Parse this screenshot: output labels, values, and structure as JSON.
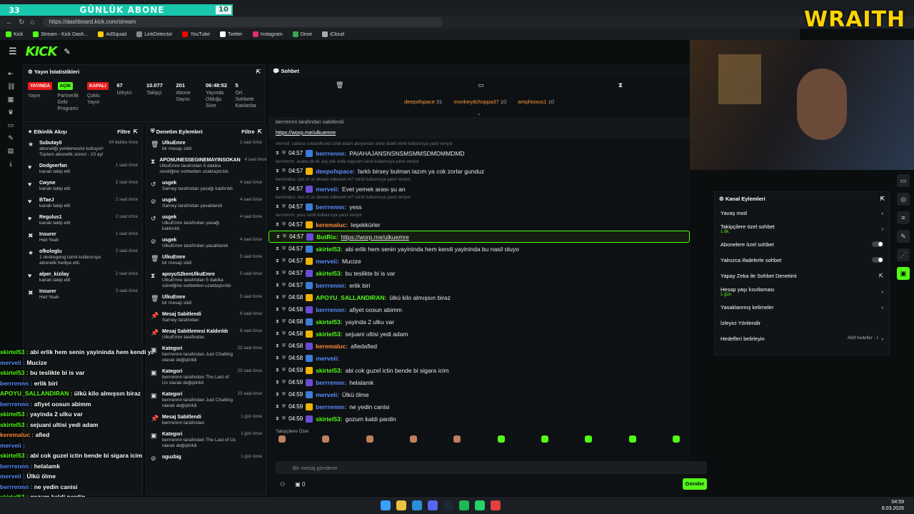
{
  "browser": {
    "url": "https://dashboard.kick.com/stream",
    "bookmarks": [
      "Kick",
      "Stream - Kick Dash...",
      "AdSquad",
      "LinkDetector",
      "YouTube",
      "Twitter",
      "Instagram",
      "Drive",
      "iCloud"
    ]
  },
  "sub_goal": {
    "count_left": "33",
    "title": "GÜNLÜK ABONE",
    "count_right": "10"
  },
  "overlay_brand": "WRAITH",
  "stats": {
    "title": "Yayın İstatistikleri",
    "items": [
      {
        "badge": "YAYINDA",
        "badge_color": "#e81c1c",
        "label": "Yayın"
      },
      {
        "badge": "AÇIK",
        "badge_color": "#53fc18",
        "label": "Partnerlik Gelir Programı"
      },
      {
        "badge": "KAPALI",
        "badge_color": "#e81c1c",
        "label": "Çoklu Yayın"
      },
      {
        "value": "67",
        "label": "İzleyici"
      },
      {
        "value": "10.077",
        "label": "Takipçi"
      },
      {
        "value": "201",
        "label": "Abone Sayısı"
      },
      {
        "value": "06:48:52",
        "label": "Yayında Olduğu Süre"
      },
      {
        "value": "5",
        "label": "Ort. Sohbete Katılanlar"
      }
    ]
  },
  "activity": {
    "title": "Etkinlik Akışı",
    "filter": "Filtre",
    "items": [
      {
        "name": "Subutay0",
        "text": "aboneliği yenilemesini kutluyor! Toplam abonelik süresi - 10 ay!",
        "time": "54 dakika önce",
        "icon": "★"
      },
      {
        "name": "Dodgeerfan",
        "text": "kanalı takip etti",
        "time": "1 saat önce",
        "icon": "♥"
      },
      {
        "name": "Cwyne",
        "text": "kanalı takip etti",
        "time": "2 saat önce",
        "icon": "♥"
      },
      {
        "name": "BTaeJ",
        "text": "kanalı takip etti",
        "time": "2 saat önce",
        "icon": "♥"
      },
      {
        "name": "Regulus1",
        "text": "kanalı takip etti",
        "time": "2 saat önce",
        "icon": "♥"
      },
      {
        "name": "Insurer",
        "text": "Heil Yeah",
        "time": "1 saat önce",
        "icon": "✖"
      },
      {
        "name": "ofkologlu",
        "text": "1 okokegeng isimli kullanıcıya abonelik hediye etti.",
        "time": "2 saat önce",
        "icon": "★"
      },
      {
        "name": "alper_kizilay",
        "text": "kanalı takip etti",
        "time": "2 saat önce",
        "icon": "♥"
      },
      {
        "name": "Insurer",
        "text": "Heil Yeah",
        "time": "3 saat önce",
        "icon": "✖"
      }
    ]
  },
  "modlog": {
    "title": "Denetim Eylemleri",
    "filter": "Filtre",
    "items": [
      {
        "name": "UlkuEmre",
        "text": "bir mesajı sildi",
        "time": "1 saat önce",
        "icon": "🗑"
      },
      {
        "name": "APONUNESSEGINEMAYINSOKAN",
        "text": "UlkuEmre tarafından 5 dakika süreliğine sohbetten uzaklaştırıldı",
        "time": "4 saat önce",
        "icon": "⧗"
      },
      {
        "name": "usgek",
        "text": "Sarney tarafından yasağı kaldırıldı",
        "time": "4 saat önce",
        "icon": "↺"
      },
      {
        "name": "usgek",
        "text": "Sarney tarafından yasaklandı",
        "time": "4 saat önce",
        "icon": "⊘"
      },
      {
        "name": "usgek",
        "text": "UlkuEmre tarafından yasağı kaldırıldı",
        "time": "4 saat önce",
        "icon": "↺"
      },
      {
        "name": "usgek",
        "text": "UlkuEmre tarafından yasaklandı",
        "time": "4 saat önce",
        "icon": "⊘"
      },
      {
        "name": "UlkuEmre",
        "text": "bir mesajı sildi",
        "time": "5 saat önce",
        "icon": "🗑"
      },
      {
        "name": "apoyuS2kenUlkuEmre",
        "text": "UlkuEmre tarafından 5 dakika süreliğine sohbetten uzaklaştırıldı",
        "time": "5 saat önce",
        "icon": "⧗"
      },
      {
        "name": "UlkuEmre",
        "text": "bir mesajı sildi",
        "time": "5 saat önce",
        "icon": "🗑"
      },
      {
        "name": "Mesaj Sabitlendi",
        "text": "Sarney tarafından",
        "time": "6 saat önce",
        "icon": "📌"
      },
      {
        "name": "Mesaj Sabitlemesi Kaldırıldı",
        "text": "UlkuEmre tarafından",
        "time": "6 saat önce",
        "icon": "📌"
      },
      {
        "name": "Kategori",
        "text": "berrrennn tarafından Just Chatting olarak değiştirildi",
        "time": "22 saat önce",
        "icon": "▣"
      },
      {
        "name": "Kategori",
        "text": "berrrennn tarafından The Last of Us olarak değiştirildi",
        "time": "23 saat önce",
        "icon": "▣"
      },
      {
        "name": "Kategori",
        "text": "berrrennn tarafından Just Chatting olarak değiştirildi",
        "time": "23 saat önce",
        "icon": "▣"
      },
      {
        "name": "Mesaj Sabitlendi",
        "text": "berrrennn tarafından",
        "time": "1 gün önce",
        "icon": "📌"
      },
      {
        "name": "Kategori",
        "text": "berrrennn tarafından The Last of Us olarak değiştirildi",
        "time": "1 gün önce",
        "icon": "▣"
      },
      {
        "name": "oguzbig",
        "text": "",
        "time": "1 gün önce",
        "icon": "⊘"
      }
    ]
  },
  "chat": {
    "title": "Sohbet",
    "leaderboard": [
      {
        "name": "deepofspace",
        "count": "31"
      },
      {
        "name": "monkeydchoppa37",
        "count": "10"
      },
      {
        "name": "amphioxus1",
        "count": "10"
      }
    ],
    "pinned_by": "berrrennn tarafından sabitlendi",
    "pinned_link": "https://worp.me/ulkuemre",
    "messages": [
      {
        "time": "04:57",
        "user": "berrrennn",
        "color": "#5b8cff",
        "text": "PAIAHAJANSNSNSMSMMSDMDMMDMD",
        "reply": "merveii: sadece cowardhood isimli adam aboyerdan dene diaeli isimli kullanıcıya yanıt veriyor"
      },
      {
        "time": "04:57",
        "user": "deepofspace",
        "color": "#5b8cff",
        "text": "farklı birsey bulman lazım ya cok zorlar gunduz",
        "reply": "berrrennn: acaba dk bir şey yok evde napcam isimli kullanıcıya yanıt veriyor"
      },
      {
        "time": "04:57",
        "user": "merveii",
        "color": "#5b8cff",
        "text": "Evet yemek arası şu an",
        "reply": "keremaluc: last of us devam edilecek mi? isimli kullanıcıya yanıt veriyor"
      },
      {
        "time": "04:57",
        "user": "berrrennn",
        "color": "#5b8cff",
        "text": "yess",
        "reply": "keremaluc: last of us devam edilecek mi? isimli kullanıcıya yanıt veriyor"
      },
      {
        "time": "04:57",
        "user": "keremaluc",
        "color": "#ff8a3d",
        "text": "teşekkürler",
        "reply": "berrrennn: yess isimli kullanıcıya yanıt veriyor"
      },
      {
        "time": "04:57",
        "user": "BotRix",
        "color": "#53fc18",
        "text": "https://worp.me/ulkuemre",
        "reply": "",
        "highlight": true
      },
      {
        "time": "04:57",
        "user": "skirtel53",
        "color": "#53fc18",
        "text": "abi erlik hem senin yayininda hem kendi yayininda bu nasil oluyo",
        "reply": ""
      },
      {
        "time": "04:57",
        "user": "merveii",
        "color": "#5b8cff",
        "text": "Mucize",
        "reply": ""
      },
      {
        "time": "04:57",
        "user": "skirtel53",
        "color": "#53fc18",
        "text": "bu teslikte bi is var",
        "reply": ""
      },
      {
        "time": "04:57",
        "user": "berrrennn",
        "color": "#5b8cff",
        "text": "erlik biri",
        "reply": ""
      },
      {
        "time": "04:58",
        "user": "APOYU_SALLANDIRAN",
        "color": "#53fc18",
        "text": "ülkü kilo almışsın biraz",
        "reply": ""
      },
      {
        "time": "04:58",
        "user": "berrrennn",
        "color": "#5b8cff",
        "text": "afiyet oosun abimm",
        "reply": ""
      },
      {
        "time": "04:58",
        "user": "skirtel53",
        "color": "#53fc18",
        "text": "yayinda 2 ulku var",
        "reply": ""
      },
      {
        "time": "04:58",
        "user": "skirtel53",
        "color": "#53fc18",
        "text": "sejuani ultisi yedi adam",
        "reply": ""
      },
      {
        "time": "04:58",
        "user": "keremaluc",
        "color": "#ff8a3d",
        "text": "afiedafied",
        "reply": ""
      },
      {
        "time": "04:58",
        "user": "merveii",
        "color": "#5b8cff",
        "text": "",
        "reply": ""
      },
      {
        "time": "04:59",
        "user": "skirtel53",
        "color": "#53fc18",
        "text": "abi cok guzel ictin bende bi sigara icim",
        "reply": ""
      },
      {
        "time": "04:59",
        "user": "berrrennn",
        "color": "#5b8cff",
        "text": "helalamk",
        "reply": ""
      },
      {
        "time": "04:59",
        "user": "merveii",
        "color": "#5b8cff",
        "text": "Ülkü ölme",
        "reply": ""
      },
      {
        "time": "04:59",
        "user": "berrrennn",
        "color": "#5b8cff",
        "text": "ne yedin canisi",
        "reply": ""
      },
      {
        "time": "04:59",
        "user": "skirtel53",
        "color": "#53fc18",
        "text": "gozum kaldi pardin",
        "reply": ""
      }
    ],
    "emote_label": "Takipçilere Özel",
    "input_placeholder": "Bir mesaj gönderin",
    "points": "0",
    "send_label": "Gönder"
  },
  "channel_actions": {
    "title": "Kanal Eylemleri",
    "items": [
      {
        "label": "Yavaş mod",
        "sub": "",
        "control": "chevron"
      },
      {
        "label": "Takipçilere özel sohbet",
        "sub": "1 dk.",
        "control": "chevron"
      },
      {
        "label": "Abonelere özel sohbet",
        "sub": "",
        "control": "toggle"
      },
      {
        "label": "Yalnızca ifadelerle sohbet",
        "sub": "",
        "control": "toggle"
      },
      {
        "label": "Yapay Zeka ile Sohbet Denetimi",
        "sub": "",
        "control": "external"
      },
      {
        "label": "Hesap yaşı kısıtlaması",
        "sub": "1 gün",
        "control": "chevron"
      },
      {
        "label": "Yasaklanmış kelimeler",
        "sub": "",
        "control": "chevron"
      },
      {
        "label": "İzleyici Yönlendir",
        "sub": "",
        "control": "none"
      },
      {
        "label": "Hedefleri belirleyin",
        "sub": "",
        "control": "chevron",
        "extra": "Aktif hedefler - 1"
      }
    ]
  },
  "overlay_chat": [
    {
      "user": "skirtel53",
      "color": "#53fc18",
      "text": "abi erlik hem senin yayininda hem kendi yayininda bu nasil oluyo"
    },
    {
      "user": "merveii",
      "color": "#5b8cff",
      "text": "Mucize"
    },
    {
      "user": "skirtel53",
      "color": "#53fc18",
      "text": "bu teslikte bi is var"
    },
    {
      "user": "berrrennn",
      "color": "#5b8cff",
      "text": "erlik biri"
    },
    {
      "user": "APOYU_SALLANDIRAN",
      "color": "#53fc18",
      "text": "ülkü kilo almışsın biraz"
    },
    {
      "user": "berrrennn",
      "color": "#5b8cff",
      "text": "afiyet oosun abimm"
    },
    {
      "user": "skirtel53",
      "color": "#53fc18",
      "text": "yayinda 2 ulku var"
    },
    {
      "user": "skirtel53",
      "color": "#53fc18",
      "text": "sejuani ultisi yedi adam"
    },
    {
      "user": "keremaluc",
      "color": "#ff8a3d",
      "text": "afied"
    },
    {
      "user": "merveii",
      "color": "#5b8cff",
      "text": ""
    },
    {
      "user": "skirtel53",
      "color": "#53fc18",
      "text": "abi cok guzel ictin bende bi sigara icim"
    },
    {
      "user": "berrrennn",
      "color": "#5b8cff",
      "text": "helalamk"
    },
    {
      "user": "merveii",
      "color": "#5b8cff",
      "text": "Ülkü ölme"
    },
    {
      "user": "berrrennn",
      "color": "#5b8cff",
      "text": "ne yedin canisi"
    },
    {
      "user": "skirtel53",
      "color": "#53fc18",
      "text": "gozum kaldi pardin"
    }
  ],
  "taskbar": {
    "time": "04:59",
    "date": "8.03.2026"
  }
}
